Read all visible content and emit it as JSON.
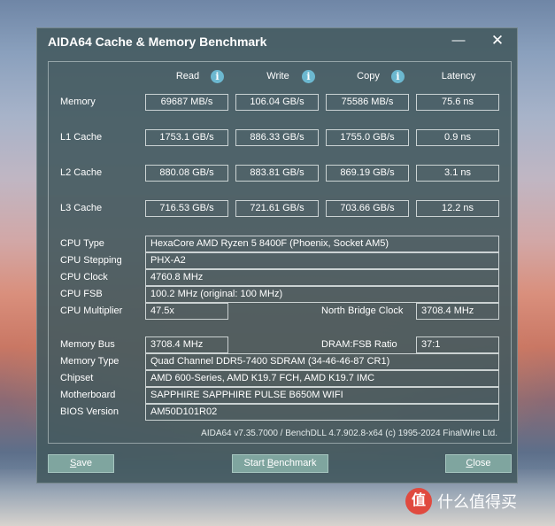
{
  "window": {
    "title": "AIDA64 Cache & Memory Benchmark",
    "minimize_glyph": "—",
    "close_glyph": "✕"
  },
  "columns": {
    "read": "Read",
    "write": "Write",
    "copy": "Copy",
    "latency": "Latency",
    "info_glyph": "i"
  },
  "bench": {
    "memory": {
      "label": "Memory",
      "read": "69687 MB/s",
      "write": "106.04 GB/s",
      "copy": "75586 MB/s",
      "latency": "75.6 ns"
    },
    "l1": {
      "label": "L1 Cache",
      "read": "1753.1 GB/s",
      "write": "886.33 GB/s",
      "copy": "1755.0 GB/s",
      "latency": "0.9 ns"
    },
    "l2": {
      "label": "L2 Cache",
      "read": "880.08 GB/s",
      "write": "883.81 GB/s",
      "copy": "869.19 GB/s",
      "latency": "3.1 ns"
    },
    "l3": {
      "label": "L3 Cache",
      "read": "716.53 GB/s",
      "write": "721.61 GB/s",
      "copy": "703.66 GB/s",
      "latency": "12.2 ns"
    }
  },
  "cpu": {
    "type_label": "CPU Type",
    "type": "HexaCore AMD Ryzen 5 8400F  (Phoenix, Socket AM5)",
    "stepping_label": "CPU Stepping",
    "stepping": "PHX-A2",
    "clock_label": "CPU Clock",
    "clock": "4760.8 MHz",
    "fsb_label": "CPU FSB",
    "fsb": "100.2 MHz  (original: 100 MHz)",
    "multiplier_label": "CPU Multiplier",
    "multiplier": "47.5x",
    "nb_clock_label": "North Bridge Clock",
    "nb_clock": "3708.4 MHz"
  },
  "memory": {
    "bus_label": "Memory Bus",
    "bus": "3708.4 MHz",
    "ratio_label": "DRAM:FSB Ratio",
    "ratio": "37:1",
    "type_label": "Memory Type",
    "type": "Quad Channel DDR5-7400 SDRAM  (34-46-46-87 CR1)",
    "chipset_label": "Chipset",
    "chipset": "AMD 600-Series, AMD K19.7 FCH, AMD K19.7 IMC",
    "motherboard_label": "Motherboard",
    "motherboard": "SAPPHIRE SAPPHIRE PULSE B650M WIFI",
    "bios_label": "BIOS Version",
    "bios": "AM50D101R02"
  },
  "footer": "AIDA64 v7.35.7000 / BenchDLL 4.7.902.8-x64  (c) 1995-2024 FinalWire Ltd.",
  "buttons": {
    "save": "Save",
    "start_u": "Start ",
    "start_rest": "Benchmark",
    "start_first": "B",
    "start_tail": "enchmark",
    "close_first": "C",
    "close_tail": "lose",
    "save_first": "S",
    "save_tail": "ave"
  },
  "watermark": {
    "logo": "值",
    "text": "什么值得买"
  }
}
